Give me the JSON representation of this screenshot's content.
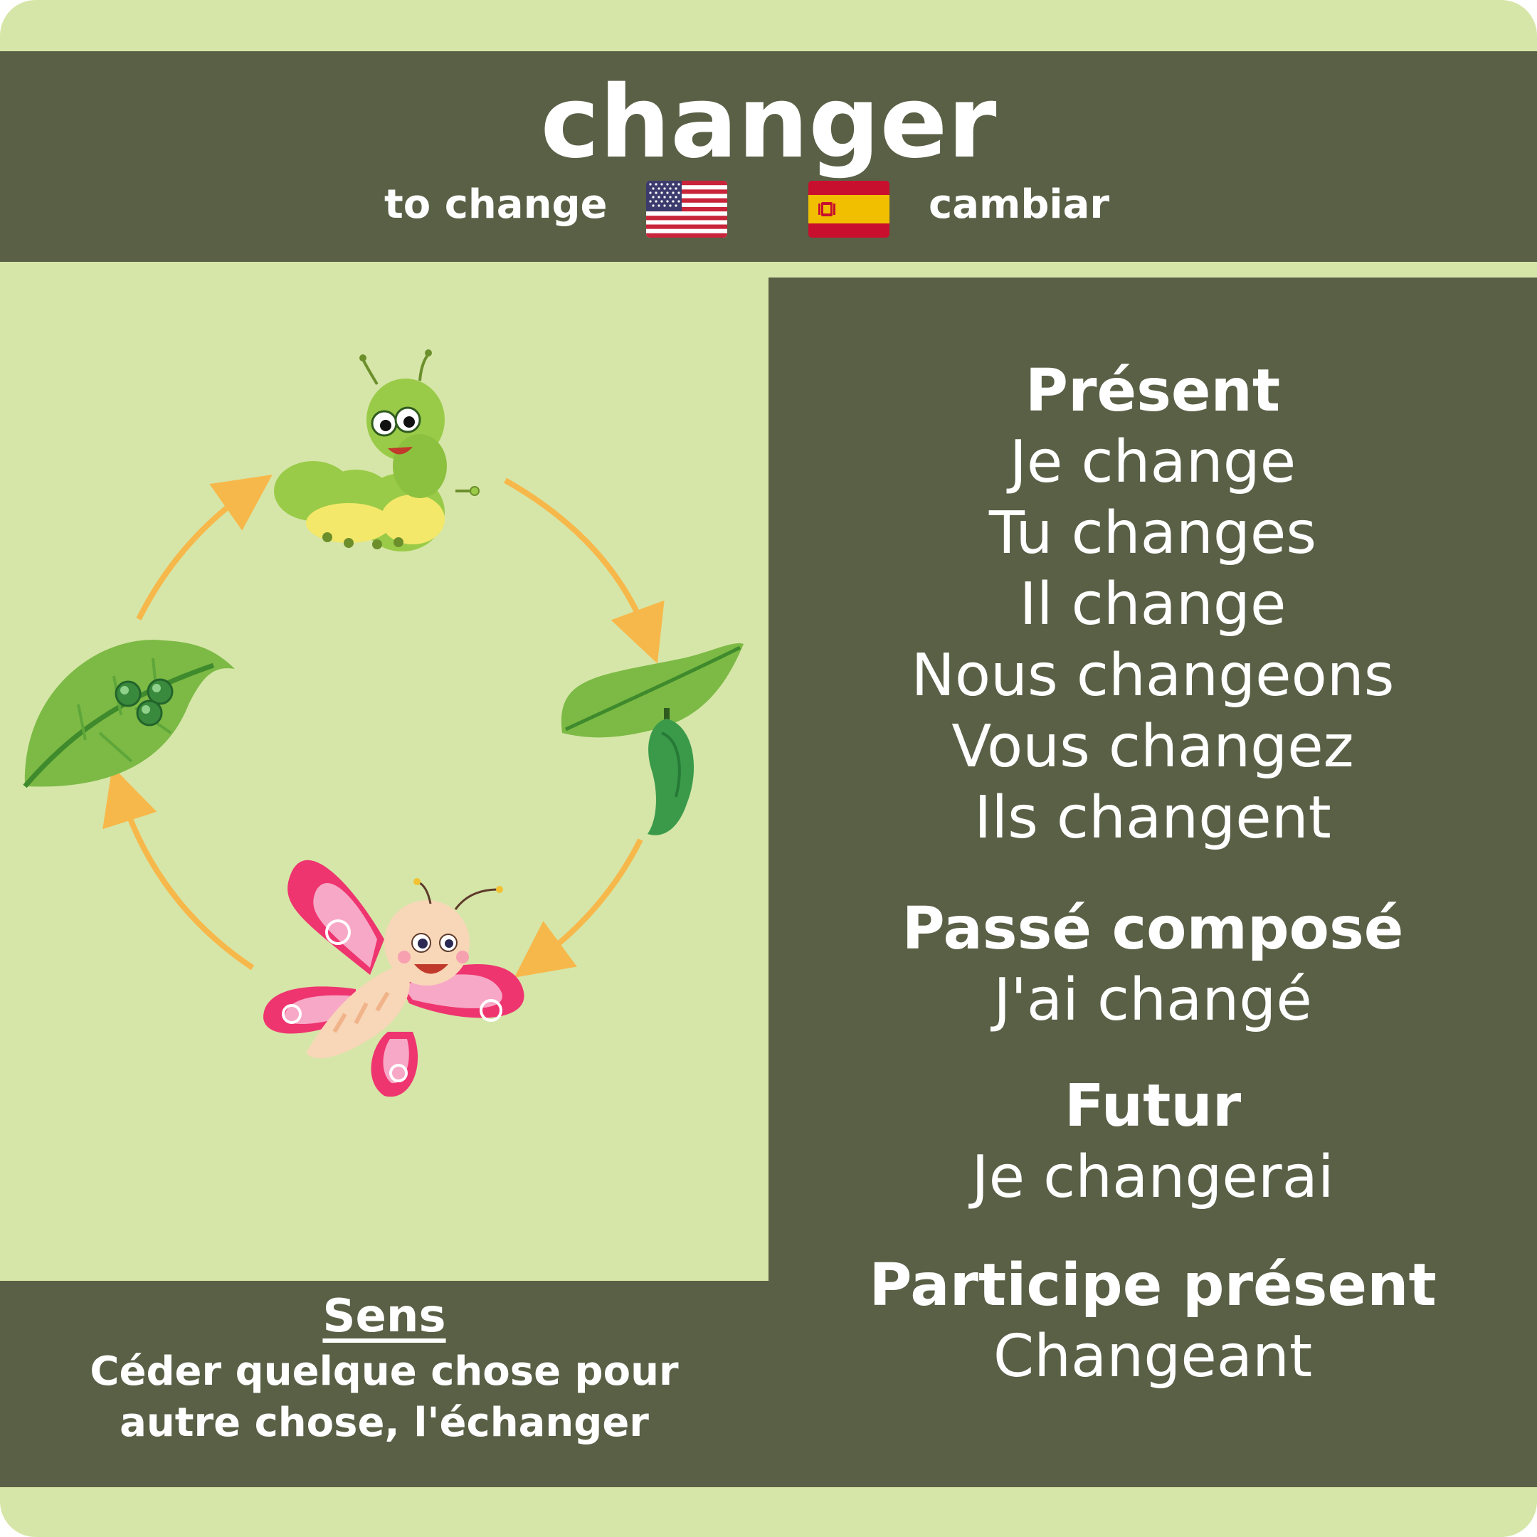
{
  "header": {
    "verb": "changer",
    "english": "to change",
    "spanish": "cambiar",
    "flags": [
      "us-flag-icon",
      "spain-flag-icon"
    ]
  },
  "conjugations": {
    "present": {
      "heading": "Présent",
      "forms": [
        "Je change",
        "Tu changes",
        "Il change",
        "Nous changeons",
        "Vous changez",
        "Ils changent"
      ]
    },
    "passe_compose": {
      "heading": "Passé composé",
      "form": "J'ai changé"
    },
    "futur": {
      "heading": "Futur",
      "form": "Je changerai"
    },
    "participe_present": {
      "heading": "Participe présent",
      "form": "Changeant"
    }
  },
  "meaning": {
    "title": "Sens",
    "text_line1": "Céder quelque chose pour",
    "text_line2": "autre chose, l'échanger"
  },
  "illustration": {
    "stages": [
      "leaf-with-eggs-icon",
      "caterpillar-icon",
      "chrysalis-icon",
      "butterfly-icon"
    ],
    "arrow_color": "#f7b84b"
  },
  "colors": {
    "background": "#d6e6a8",
    "panel": "#5a6046",
    "text": "#ffffff"
  }
}
